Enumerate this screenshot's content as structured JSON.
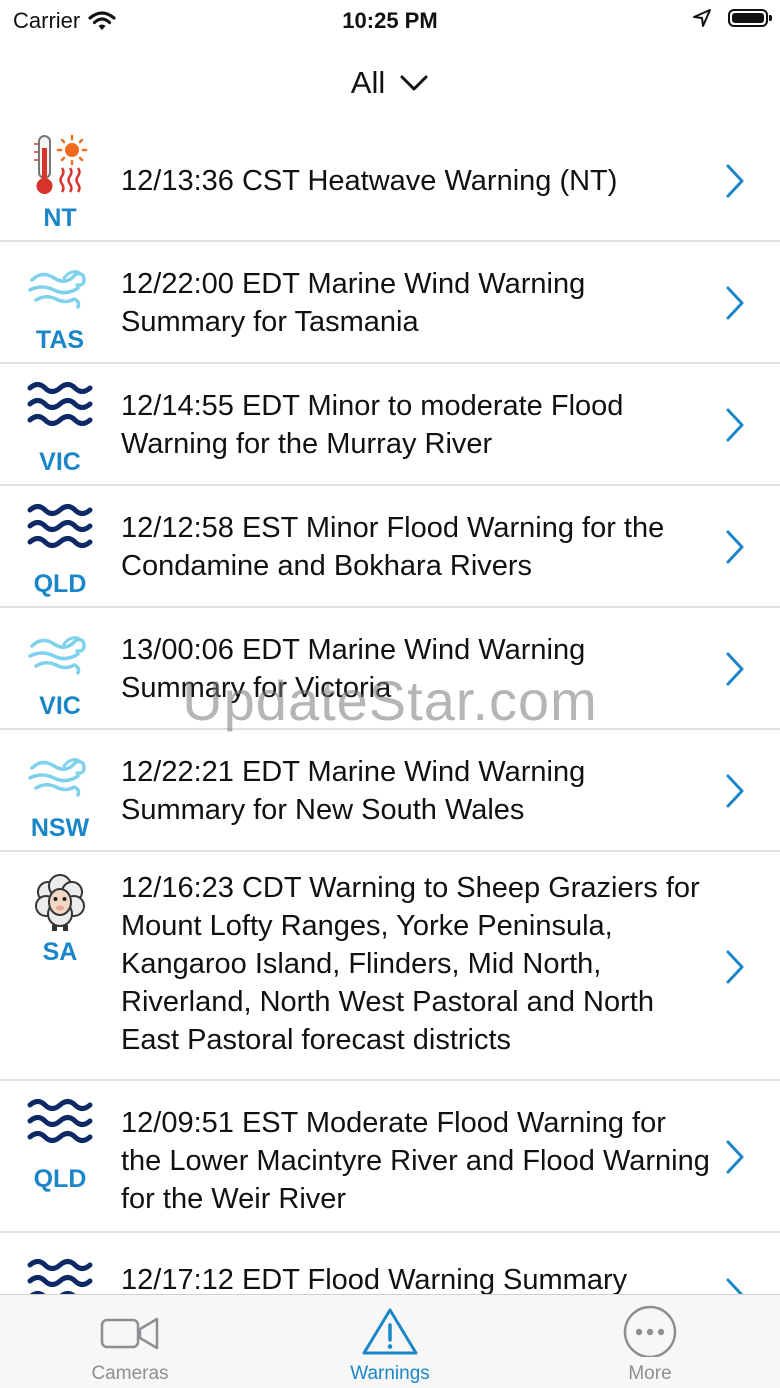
{
  "status_bar": {
    "carrier": "Carrier",
    "time": "10:25 PM"
  },
  "nav": {
    "title": "All"
  },
  "warnings": [
    {
      "state": "NT",
      "icon": "heatwave-icon",
      "text": "12/13:36 CST Heatwave Warning (NT)"
    },
    {
      "state": "TAS",
      "icon": "wind-icon",
      "text": "12/22:00 EDT Marine Wind Warning Summary for Tasmania"
    },
    {
      "state": "VIC",
      "icon": "flood-icon",
      "text": "12/14:55 EDT Minor to moderate Flood Warning for the Murray River"
    },
    {
      "state": "QLD",
      "icon": "flood-icon",
      "text": "12/12:58 EST Minor Flood Warning for the Condamine and Bokhara Rivers"
    },
    {
      "state": "VIC",
      "icon": "wind-icon",
      "text": "13/00:06 EDT Marine Wind Warning Summary for Victoria"
    },
    {
      "state": "NSW",
      "icon": "wind-icon",
      "text": "12/22:21 EDT Marine Wind Warning Summary for New South Wales"
    },
    {
      "state": "SA",
      "icon": "sheep-icon",
      "text": "12/16:23 CDT Warning to Sheep Graziers for Mount Lofty Ranges, Yorke Peninsula, Kangaroo Island, Flinders, Mid North, Riverland, North West Pastoral and North East Pastoral forecast districts"
    },
    {
      "state": "QLD",
      "icon": "flood-icon",
      "text": "12/09:51 EST Moderate Flood Warning for the Lower Macintyre River and Flood Warning for the Weir River"
    },
    {
      "state": "",
      "icon": "flood-icon",
      "text": "12/17:12 EDT Flood Warning Summary"
    }
  ],
  "watermark": "UpdateStar.com",
  "tabbar": {
    "cameras": "Cameras",
    "warnings": "Warnings",
    "more": "More"
  },
  "colors": {
    "accent": "#1a86c8",
    "flood_wave": "#0d2a66",
    "wind": "#7fd1ee",
    "inactive": "#8e8e93"
  }
}
